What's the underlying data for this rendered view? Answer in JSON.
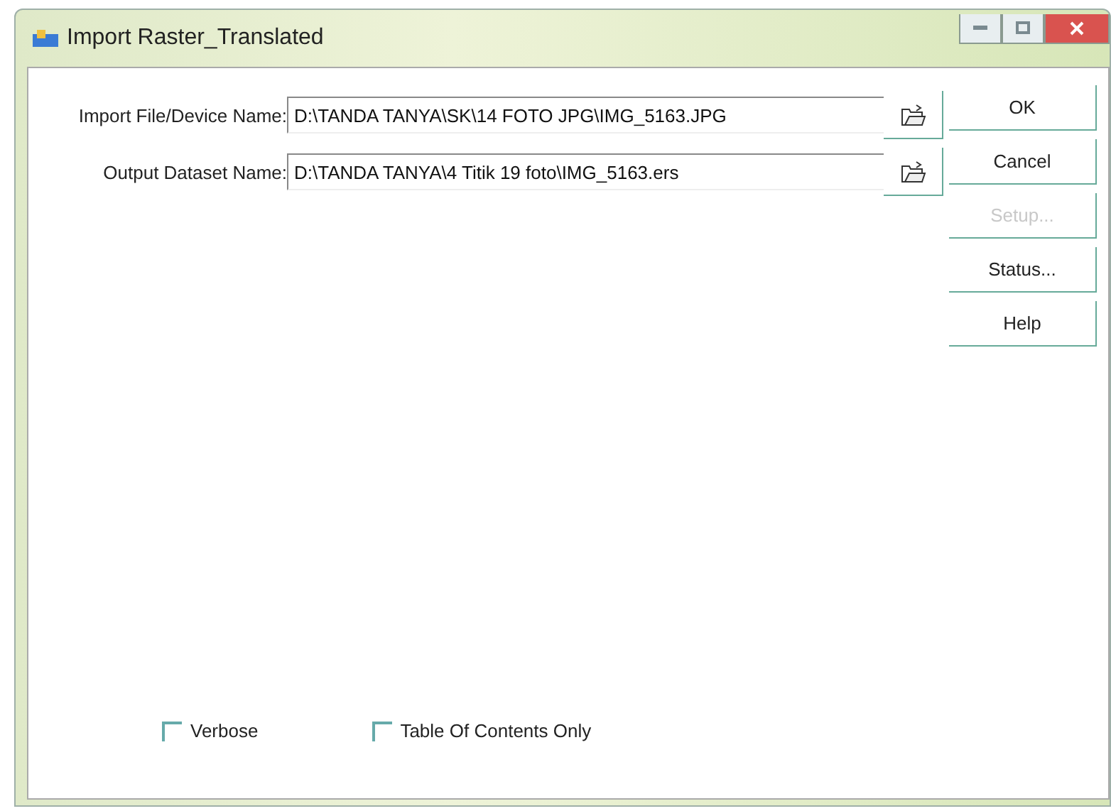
{
  "window": {
    "title": "Import Raster_Translated"
  },
  "fields": [
    {
      "label": "Import File/Device Name:",
      "value": "D:\\TANDA TANYA\\SK\\14 FOTO JPG\\IMG_5163.JPG"
    },
    {
      "label": "Output Dataset Name:",
      "value": "D:\\TANDA TANYA\\4 Titik 19 foto\\IMG_5163.ers"
    }
  ],
  "buttons": [
    {
      "label": "OK",
      "disabled": false
    },
    {
      "label": "Cancel",
      "disabled": false
    },
    {
      "label": "Setup...",
      "disabled": true
    },
    {
      "label": "Status...",
      "disabled": false
    },
    {
      "label": "Help",
      "disabled": false
    }
  ],
  "options": [
    {
      "label": "Verbose",
      "checked": false
    },
    {
      "label": "Table Of Contents Only",
      "checked": false
    }
  ]
}
